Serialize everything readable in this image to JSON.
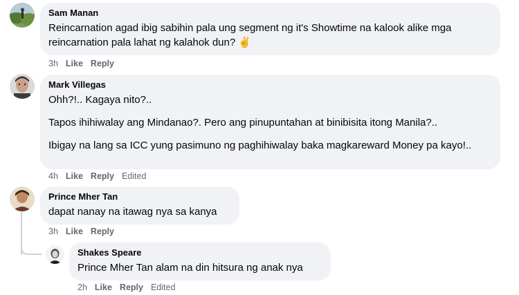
{
  "comments": [
    {
      "author": "Sam Manan",
      "paragraphs": [
        "Reincarnation agad ibig sabihin pala ung segment ng it's Showtime na kalook alike mga reincarnation pala lahat ng kalahok dun? ✌️"
      ],
      "time": "3h",
      "like": "Like",
      "reply": "Reply"
    },
    {
      "author": "Mark Villegas",
      "paragraphs": [
        "Ohh?!.. Kagaya nito?..",
        "Tapos ihihiwalay ang Mindanao?. Pero ang pinupuntahan at binibisita itong Manila?..",
        "Ibigay na lang sa ICC yung pasimuno ng paghihiwalay baka magkareward Money pa kayo!.."
      ],
      "time": "4h",
      "like": "Like",
      "reply": "Reply",
      "edited": "Edited"
    },
    {
      "author": "Prince Mher Tan",
      "paragraphs": [
        "dapat nanay na itawag nya sa kanya"
      ],
      "time": "3h",
      "like": "Like",
      "reply": "Reply"
    },
    {
      "author": "Shakes Speare",
      "paragraphs": [
        "Prince Mher Tan alam na din hitsura ng anak nya"
      ],
      "time": "2h",
      "like": "Like",
      "reply": "Reply",
      "edited": "Edited"
    }
  ]
}
